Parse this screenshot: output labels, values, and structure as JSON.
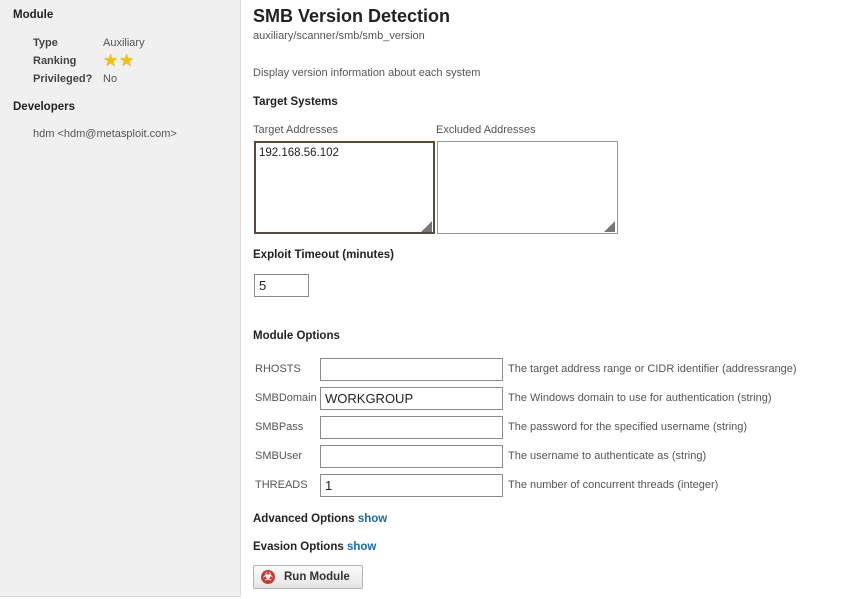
{
  "sidebar": {
    "module_heading": "Module",
    "type_label": "Type",
    "type_value": "Auxiliary",
    "ranking_label": "Ranking",
    "ranking_stars": 2,
    "privileged_label": "Privileged?",
    "privileged_value": "No",
    "developers_heading": "Developers",
    "developer": "hdm <hdm@metasploit.com>"
  },
  "module": {
    "title": "SMB Version Detection",
    "path": "auxiliary/scanner/smb/smb_version",
    "description": "Display version information about each system"
  },
  "targets": {
    "heading": "Target Systems",
    "target_label": "Target Addresses",
    "target_value": "192.168.56.102",
    "excluded_label": "Excluded Addresses",
    "excluded_value": ""
  },
  "timeout": {
    "heading": "Exploit Timeout (minutes)",
    "value": "5"
  },
  "options": {
    "heading": "Module Options",
    "rows": [
      {
        "name": "RHOSTS",
        "value": "",
        "desc": "The target address range or CIDR identifier (addressrange)"
      },
      {
        "name": "SMBDomain",
        "value": "WORKGROUP",
        "desc": "The Windows domain to use for authentication (string)"
      },
      {
        "name": "SMBPass",
        "value": "",
        "desc": "The password for the specified username (string)"
      },
      {
        "name": "SMBUser",
        "value": "",
        "desc": "The username to authenticate as (string)"
      },
      {
        "name": "THREADS",
        "value": "1",
        "desc": "The number of concurrent threads (integer)"
      }
    ]
  },
  "advanced": {
    "label": "Advanced Options",
    "link": "show"
  },
  "evasion": {
    "label": "Evasion Options",
    "link": "show"
  },
  "run_button": {
    "label": "Run Module",
    "icon": "biohazard-icon"
  },
  "colors": {
    "link": "#176ba8",
    "star": "#f2c20f",
    "run_icon": "#c53b34"
  }
}
